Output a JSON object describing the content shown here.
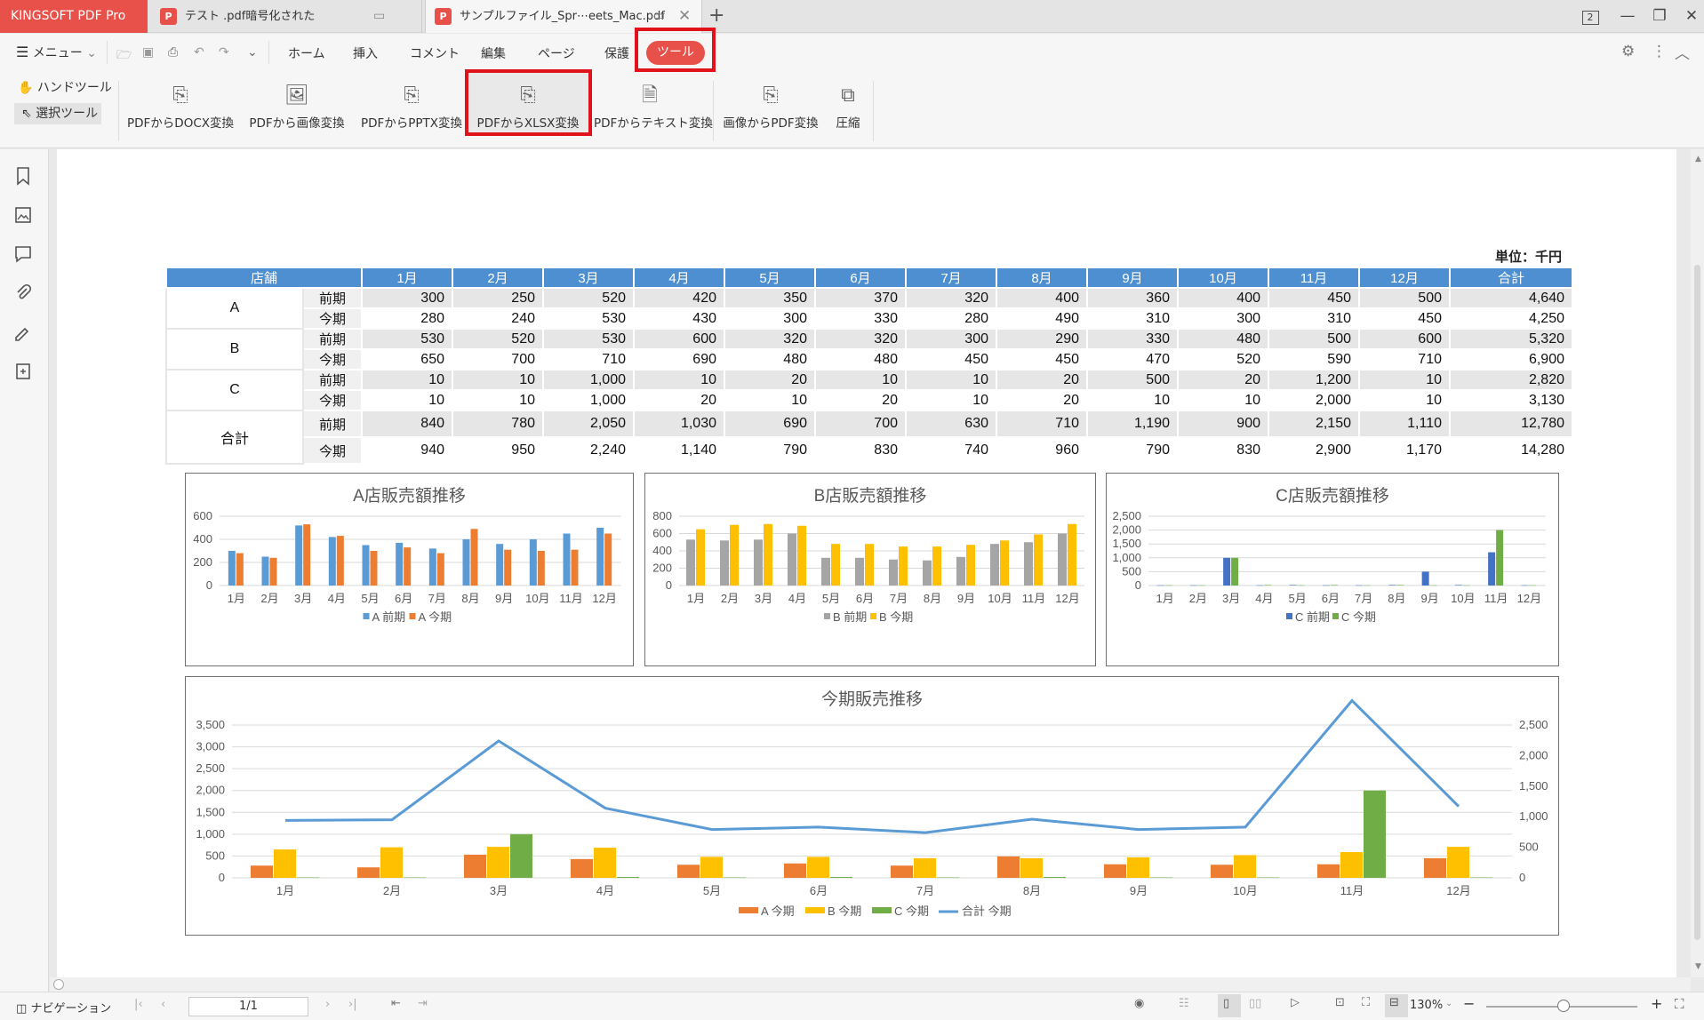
{
  "app_title": "KINGSOFT PDF Pro",
  "tabs": [
    {
      "label": "テスト .pdf暗号化された"
    },
    {
      "label": "サンプルファイル_Spr⋯eets_Mac.pdf"
    }
  ],
  "window_badge": "2",
  "menu": {
    "menu_label": "メニュー",
    "tabs": [
      "ホーム",
      "挿入",
      "コメント",
      "編集",
      "ページ",
      "保護",
      "ツール"
    ],
    "active_tab": "ツール"
  },
  "ribbon": {
    "hand_tool": "ハンドツール",
    "select_tool": "選択ツール",
    "tools": [
      {
        "label": "PDFからDOCX変換",
        "icon": "pdf-to-docx-icon"
      },
      {
        "label": "PDFから画像変換",
        "icon": "pdf-to-image-icon"
      },
      {
        "label": "PDFからPPTX変換",
        "icon": "pdf-to-pptx-icon"
      },
      {
        "label": "PDFからXLSX変換",
        "icon": "pdf-to-xlsx-icon"
      },
      {
        "label": "PDFからテキスト変換",
        "icon": "pdf-to-text-icon"
      },
      {
        "label": "画像からPDF変換",
        "icon": "image-to-pdf-icon"
      },
      {
        "label": "圧縮",
        "icon": "compress-icon"
      }
    ],
    "highlight_color": "#e0121c"
  },
  "document": {
    "unit": "単位：千円",
    "table": {
      "header": [
        "店舗",
        "1月",
        "2月",
        "3月",
        "4月",
        "5月",
        "6月",
        "7月",
        "8月",
        "9月",
        "10月",
        "11月",
        "12月",
        "合計"
      ],
      "rows": [
        {
          "store": "A",
          "kind": "前期",
          "values": [
            "300",
            "250",
            "520",
            "420",
            "350",
            "370",
            "320",
            "400",
            "360",
            "400",
            "450",
            "500",
            "4,640"
          ]
        },
        {
          "store": "",
          "kind": "今期",
          "values": [
            "280",
            "240",
            "530",
            "430",
            "300",
            "330",
            "280",
            "490",
            "310",
            "300",
            "310",
            "450",
            "4,250"
          ]
        },
        {
          "store": "B",
          "kind": "前期",
          "values": [
            "530",
            "520",
            "530",
            "600",
            "320",
            "320",
            "300",
            "290",
            "330",
            "480",
            "500",
            "600",
            "5,320"
          ]
        },
        {
          "store": "",
          "kind": "今期",
          "values": [
            "650",
            "700",
            "710",
            "690",
            "480",
            "480",
            "450",
            "450",
            "470",
            "520",
            "590",
            "710",
            "6,900"
          ]
        },
        {
          "store": "C",
          "kind": "前期",
          "values": [
            "10",
            "10",
            "1,000",
            "10",
            "20",
            "10",
            "10",
            "20",
            "500",
            "20",
            "1,200",
            "10",
            "2,820"
          ]
        },
        {
          "store": "",
          "kind": "今期",
          "values": [
            "10",
            "10",
            "1,000",
            "20",
            "10",
            "20",
            "10",
            "20",
            "10",
            "10",
            "2,000",
            "10",
            "3,130"
          ]
        },
        {
          "store": "合計",
          "kind": "前期",
          "values": [
            "840",
            "780",
            "2,050",
            "1,030",
            "690",
            "700",
            "630",
            "710",
            "1,190",
            "900",
            "2,150",
            "1,110",
            "12,780"
          ]
        },
        {
          "store": "",
          "kind": "今期",
          "values": [
            "940",
            "950",
            "2,240",
            "1,140",
            "790",
            "830",
            "740",
            "960",
            "790",
            "830",
            "2,900",
            "1,170",
            "14,280"
          ]
        }
      ]
    }
  },
  "chart_data": [
    {
      "type": "bar",
      "title": "A店販売額推移",
      "categories": [
        "1月",
        "2月",
        "3月",
        "4月",
        "5月",
        "6月",
        "7月",
        "8月",
        "9月",
        "10月",
        "11月",
        "12月"
      ],
      "ylim": [
        0,
        600
      ],
      "yticks": [
        "0",
        "200",
        "400",
        "600"
      ],
      "series": [
        {
          "name": "A 前期",
          "color": "#5b9bd5",
          "values": [
            300,
            250,
            520,
            420,
            350,
            370,
            320,
            400,
            360,
            400,
            450,
            500
          ]
        },
        {
          "name": "A 今期",
          "color": "#ed7d31",
          "values": [
            280,
            240,
            530,
            430,
            300,
            330,
            280,
            490,
            310,
            300,
            310,
            450
          ]
        }
      ],
      "legend": "bottom"
    },
    {
      "type": "bar",
      "title": "B店販売額推移",
      "categories": [
        "1月",
        "2月",
        "3月",
        "4月",
        "5月",
        "6月",
        "7月",
        "8月",
        "9月",
        "10月",
        "11月",
        "12月"
      ],
      "ylim": [
        0,
        800
      ],
      "yticks": [
        "0",
        "200",
        "400",
        "600",
        "800"
      ],
      "series": [
        {
          "name": "B 前期",
          "color": "#a5a5a5",
          "values": [
            530,
            520,
            530,
            600,
            320,
            320,
            300,
            290,
            330,
            480,
            500,
            600
          ]
        },
        {
          "name": "B 今期",
          "color": "#ffc000",
          "values": [
            650,
            700,
            710,
            690,
            480,
            480,
            450,
            450,
            470,
            520,
            590,
            710
          ]
        }
      ],
      "legend": "bottom"
    },
    {
      "type": "bar",
      "title": "C店販売額推移",
      "categories": [
        "1月",
        "2月",
        "3月",
        "4月",
        "5月",
        "6月",
        "7月",
        "8月",
        "9月",
        "10月",
        "11月",
        "12月"
      ],
      "ylim": [
        0,
        2500
      ],
      "yticks": [
        "0",
        "500",
        "1,000",
        "1,500",
        "2,000",
        "2,500"
      ],
      "series": [
        {
          "name": "C 前期",
          "color": "#4472c4",
          "values": [
            10,
            10,
            1000,
            10,
            20,
            10,
            10,
            20,
            500,
            20,
            1200,
            10
          ]
        },
        {
          "name": "C 今期",
          "color": "#70ad47",
          "values": [
            10,
            10,
            1000,
            20,
            10,
            20,
            10,
            20,
            10,
            10,
            2000,
            10
          ]
        }
      ],
      "legend": "bottom"
    },
    {
      "type": "bar",
      "title": "今期販売推移",
      "categories": [
        "1月",
        "2月",
        "3月",
        "4月",
        "5月",
        "6月",
        "7月",
        "8月",
        "9月",
        "10月",
        "11月",
        "12月"
      ],
      "ylim": [
        0,
        3500
      ],
      "yticks": [
        "0",
        "500",
        "1,000",
        "1,500",
        "2,000",
        "2,500",
        "3,000",
        "3,500"
      ],
      "y2lim": [
        0,
        2500
      ],
      "y2ticks": [
        "0",
        "500",
        "1,000",
        "1,500",
        "2,000",
        "2,500"
      ],
      "series": [
        {
          "name": "A 今期",
          "color": "#ed7d31",
          "kind": "bar",
          "values": [
            280,
            240,
            530,
            430,
            300,
            330,
            280,
            490,
            310,
            300,
            310,
            450
          ]
        },
        {
          "name": "B 今期",
          "color": "#ffc000",
          "kind": "bar",
          "values": [
            650,
            700,
            710,
            690,
            480,
            480,
            450,
            450,
            470,
            520,
            590,
            710
          ]
        },
        {
          "name": "C 今期",
          "color": "#70ad47",
          "kind": "bar",
          "values": [
            10,
            10,
            1000,
            20,
            10,
            20,
            10,
            20,
            10,
            10,
            2000,
            10
          ]
        },
        {
          "name": "合計 今期",
          "color": "#5b9bd5",
          "kind": "line",
          "axis": "right",
          "values": [
            940,
            950,
            2240,
            1140,
            790,
            830,
            740,
            960,
            790,
            830,
            2900,
            1170
          ]
        }
      ],
      "legend": "bottom"
    }
  ],
  "status": {
    "navigation": "ナビゲーション",
    "page_indicator": "1/1",
    "zoom": "130%"
  }
}
